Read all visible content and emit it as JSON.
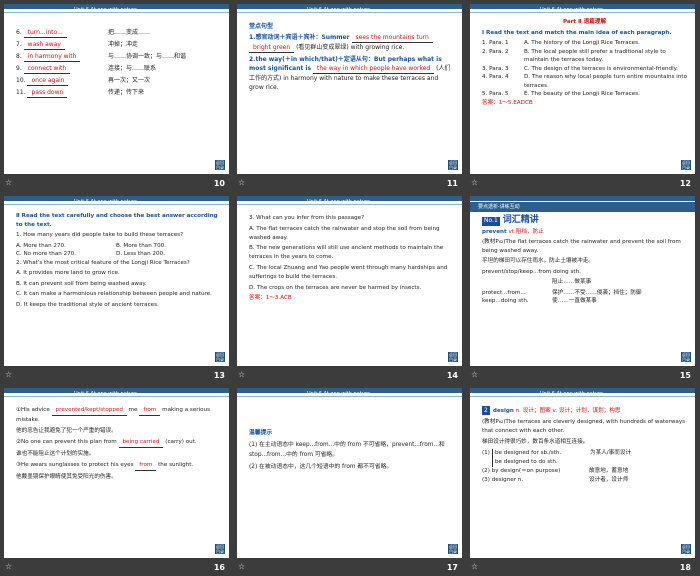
{
  "header_text": "Unit 6   At one with nature",
  "corner_label": "返回目录",
  "slides": [
    {
      "num": "10",
      "lines": [
        {
          "n": "6.",
          "ans": "turn...into...",
          "cn": "把……变成……"
        },
        {
          "n": "7.",
          "ans": "wash away",
          "cn": "冲掉；冲走"
        },
        {
          "n": "8.",
          "ans": "in harmony with",
          "cn": "与……协调一致；与……和谐"
        },
        {
          "n": "9.",
          "ans": "connect with",
          "cn": "连接；与……联系"
        },
        {
          "n": "10.",
          "ans": "once again",
          "cn": "再一次；又一次"
        },
        {
          "n": "11.",
          "ans": "pass down",
          "cn": "传递；传下来"
        }
      ]
    },
    {
      "num": "11",
      "title": "堂点句型",
      "s1_pre": "1.感官动词＋宾语＋宾补：Summer",
      "s1_ans1": "sees the mountains turn",
      "s1_ans2": "bright green",
      "s1_cn": "(看见群山变成翠绿) with growing rice.",
      "s2_pre": "2.the way(＋in which/that)＋定语从句：But perhaps what is most significant is",
      "s2_ans": "the way in which people have worked",
      "s2_cn": "(人们工作的方式) in harmony with nature to make these terraces and grow rice."
    },
    {
      "num": "12",
      "part": "Part Ⅱ  语篇理解",
      "q": "Ⅰ Read the text and match the main idea of each paragraph.",
      "items": [
        {
          "p": "1. Para. 1",
          "t": "A. The history of the Longji Rice Terraces."
        },
        {
          "p": "2. Para. 2",
          "t": "B. The local people still prefer a traditional style to maintain the terraces today."
        },
        {
          "p": "3. Para. 3",
          "t": "C. The design of the terraces is environmental-friendly."
        },
        {
          "p": "4. Para. 4",
          "t": "D. The reason why local people turn entire mountains into terraces."
        },
        {
          "p": "5. Para. 5",
          "t": "E. The beauty of the Longji Rice Terraces."
        }
      ],
      "answer": "答案：1～5.EADCB"
    },
    {
      "num": "13",
      "q": "Ⅱ Read the text carefully and choose the best answer according to the text.",
      "q1": "1. How many years did people take to build these terraces?",
      "q1a": "A. More than 270.",
      "q1b": "B. More than 700.",
      "q1c": "C. No more than 270.",
      "q1d": "D. Less than 200.",
      "q2": "2. What's the most critical feature of the Longji Rice Terraces?",
      "q2a": "A. It provides more land to grow rice.",
      "q2b": "B. It can prevent soil from being washed away.",
      "q2c": "C. It can make a harmonious relationship between people and nature.",
      "q2d": "D. It keeps the traditional style of ancient terraces."
    },
    {
      "num": "14",
      "q": "3. What can you infer from this passage?",
      "a": "A. The flat terraces catch the rainwater and stop the soil from being washed away.",
      "b": "B. The new generations will still use ancient methods to maintain the terraces in the years to come.",
      "c": "C. The local Zhuang and Yao people went through many hardships and sufferings to build the terraces.",
      "d": "D. The crops on the terraces are never be harmed by insects.",
      "answer": "答案：1～3.ACB"
    },
    {
      "num": "15",
      "band": "要点透析·讲练互动",
      "word_title": "词汇精讲",
      "no": "No.1",
      "word": "prevent",
      "word_def": "vt.阻挡，防止",
      "ex": "(教材P₆₂)The flat terraces catch the rainwater and prevent the soil from being washed away.",
      "ex_cn": "平坦的梯田可以存住雨水，防止土壤被冲走。",
      "phr": "prevent/stop/keep...from doing sth.",
      "phr_cn": "阻止……做某事",
      "p2": "protect...from...",
      "p2_cn": "保护……不受……侵袭；挡住；防御",
      "p3": "keep...doing sth.",
      "p3_cn": "使……一直做某事"
    },
    {
      "num": "16",
      "l1": "①His advice",
      "l1a": "prevented/kept/stopped",
      "l1b": "me",
      "l1c": "from",
      "l1d": "making a serious mistake.",
      "l1cn": "他的忠告让我避免了犯一个严重的错误。",
      "l2": "②No one can prevent this plan from",
      "l2a": "being carried",
      "l2b": "(carry) out.",
      "l2cn": "谁也不能阻止这个计划的实施。",
      "l3": "③He wears sunglasses to protect his eyes",
      "l3a": "from",
      "l3b": "the sunlight.",
      "l3cn": "他戴墨镜保护眼睛使其免受阳光的伤害。"
    },
    {
      "num": "17",
      "title": "温馨提示",
      "t1": "(1) 在主动语态中 keep...from...中的 from 不可省略，prevent...from...和 stop...from...中的 from 可省略。",
      "t2": "(2) 在被动语态中，这几个短语中的 from 都不可省略。"
    },
    {
      "num": "18",
      "no": "2",
      "word": "design",
      "word_def": "n. 设计；图案  v. 设计；计划，谋划；构思",
      "ex": "(教材P₆₂)The terraces are cleverly designed, with hundreds of waterways that connect with each other.",
      "ex_cn": "梯田设计得很巧妙，数百条水道相互连接。",
      "r1": "(1)",
      "r1a": "be designed for sb./sth.",
      "r1b": "be designed to do sth.",
      "r1cn": "为某人/事而设计",
      "r2": "(2) by design(＝on purpose)",
      "r2cn": "故意地，蓄意地",
      "r3": "(3) designer n.",
      "r3cn": "设计者，设计师"
    }
  ]
}
